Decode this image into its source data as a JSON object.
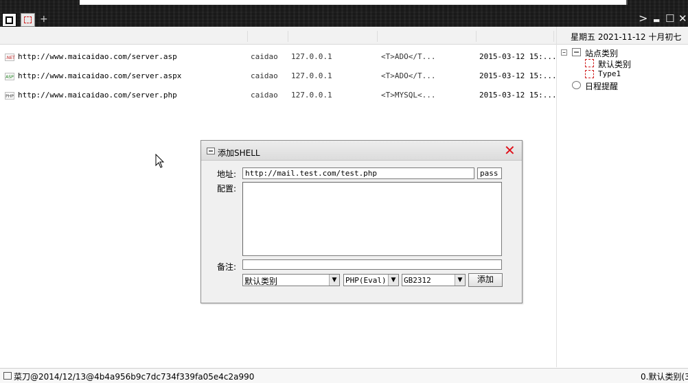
{
  "topbar": {
    "tabs": [
      {
        "name": "active-tab-icon"
      },
      {
        "name": "shell-tab-icon"
      }
    ],
    "add_tab": "+",
    "controls": {
      "more": ">",
      "minimize": "▬",
      "maximize": "☐",
      "close": "✕"
    }
  },
  "list": {
    "rows": [
      {
        "type": ".NET",
        "url": "http://www.maicaidao.com/server.asp",
        "user": "caidao",
        "ip": "127.0.0.1",
        "db": "<T>ADO</T...",
        "date": "2015-03-12 15:..."
      },
      {
        "type": "ASP",
        "url": "http://www.maicaidao.com/server.aspx",
        "user": "caidao",
        "ip": "127.0.0.1",
        "db": "<T>ADO</T...",
        "date": "2015-03-12 15:..."
      },
      {
        "type": "PHP",
        "url": "http://www.maicaidao.com/server.php",
        "user": "caidao",
        "ip": "127.0.0.1",
        "db": "<T>MYSQL<...",
        "date": "2015-03-12 15:..."
      }
    ]
  },
  "right_panel": {
    "date_header": "星期五  2021-11-12  十月初七",
    "tree": {
      "root_label": "站点类别",
      "root_expand": "−",
      "children": [
        "默认类别",
        "Type1"
      ],
      "schedule_label": "日程提醒"
    }
  },
  "dialog": {
    "title": "添加SHELL",
    "close": "✕",
    "address_label": "地址:",
    "address_value": "http://mail.test.com/test.php",
    "password_value": "pass",
    "config_label": "配置:",
    "config_value": "",
    "note_label": "备注:",
    "note_value": "",
    "category_select": "默认类别",
    "script_select": "PHP(Eval)",
    "encoding_select": "GB2312",
    "add_button": "添加"
  },
  "status_bar": {
    "left_text": "菜刀@2014/12/13@4b4a956b9c7dc734f339fa05e4c2a990",
    "right_text": "0.默认类别(3"
  },
  "colors": {
    "topbar_bg": "#1b1b1b",
    "close_red": "#e0101a",
    "icon_red": "#d02020"
  }
}
